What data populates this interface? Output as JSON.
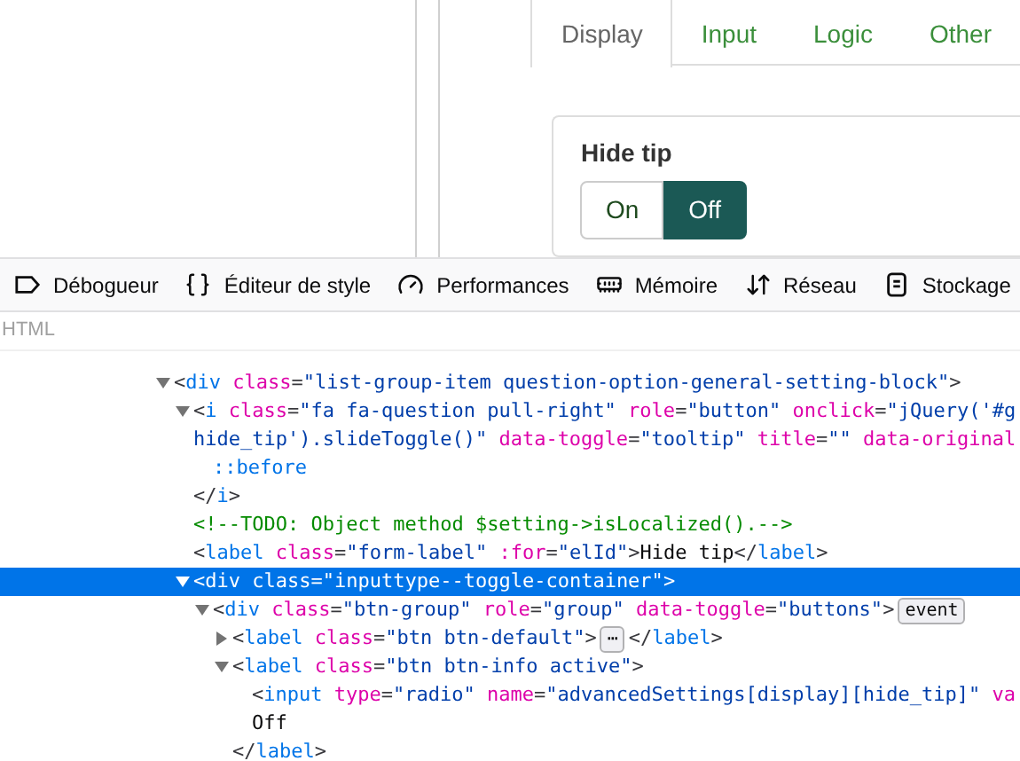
{
  "page": {
    "tabs": [
      {
        "label": "Display",
        "selected": true
      },
      {
        "label": "Input",
        "selected": false
      },
      {
        "label": "Logic",
        "selected": false
      },
      {
        "label": "Other",
        "selected": false
      }
    ],
    "setting": {
      "label": "Hide tip",
      "options": [
        {
          "label": "On",
          "selected": false
        },
        {
          "label": "Off",
          "selected": true
        }
      ]
    }
  },
  "devtools": {
    "tools": [
      {
        "kind": "debugger",
        "label": "Débogueur"
      },
      {
        "kind": "style",
        "label": "Éditeur de style"
      },
      {
        "kind": "performance",
        "label": "Performances"
      },
      {
        "kind": "memory",
        "label": "Mémoire"
      },
      {
        "kind": "network",
        "label": "Réseau"
      },
      {
        "kind": "storage",
        "label": "Stockage"
      }
    ],
    "breadcrumb": "HTML",
    "tree": [
      {
        "expanded": true,
        "selected": false,
        "lines": [
          [
            {
              "kind": "p",
              "text": "<"
            },
            {
              "kind": "tag",
              "text": "div"
            },
            {
              "kind": "attr",
              "text": " class"
            },
            {
              "kind": "p",
              "text": "="
            },
            {
              "kind": "val",
              "text": "\"list-group-item question-option-general-setting-block\""
            },
            {
              "kind": "p",
              "text": ">"
            }
          ]
        ],
        "children": [
          {
            "expanded": true,
            "selected": false,
            "lines": [
              [
                {
                  "kind": "p",
                  "text": "<"
                },
                {
                  "kind": "tag",
                  "text": "i"
                },
                {
                  "kind": "attr",
                  "text": " class"
                },
                {
                  "kind": "p",
                  "text": "="
                },
                {
                  "kind": "val",
                  "text": "\"fa fa-question pull-right\""
                },
                {
                  "kind": "attr",
                  "text": " role"
                },
                {
                  "kind": "p",
                  "text": "="
                },
                {
                  "kind": "val",
                  "text": "\"button\""
                },
                {
                  "kind": "attr",
                  "text": " onclick"
                },
                {
                  "kind": "p",
                  "text": "="
                },
                {
                  "kind": "val",
                  "text": "\"jQuery('#g"
                }
              ],
              [
                {
                  "kind": "val",
                  "text": "hide_tip').slideToggle()\""
                },
                {
                  "kind": "attr",
                  "text": " data-toggle"
                },
                {
                  "kind": "p",
                  "text": "="
                },
                {
                  "kind": "val",
                  "text": "\"tooltip\""
                },
                {
                  "kind": "attr",
                  "text": " title"
                },
                {
                  "kind": "p",
                  "text": "="
                },
                {
                  "kind": "val",
                  "text": "\"\""
                },
                {
                  "kind": "attr",
                  "text": " data-original"
                }
              ]
            ],
            "children": [
              {
                "selected": false,
                "lines": [
                  [
                    {
                      "kind": "pseudo",
                      "text": "::before"
                    }
                  ]
                ]
              }
            ]
          },
          {
            "selected": false,
            "lines": [
              [
                {
                  "kind": "p",
                  "text": "</"
                },
                {
                  "kind": "tag",
                  "text": "i"
                },
                {
                  "kind": "p",
                  "text": ">"
                }
              ]
            ]
          },
          {
            "selected": false,
            "lines": [
              [
                {
                  "kind": "comment",
                  "text": "<!--TODO: Object method $setting->isLocalized().-->"
                }
              ]
            ]
          },
          {
            "selected": false,
            "lines": [
              [
                {
                  "kind": "p",
                  "text": "<"
                },
                {
                  "kind": "tag",
                  "text": "label"
                },
                {
                  "kind": "attr",
                  "text": " class"
                },
                {
                  "kind": "p",
                  "text": "="
                },
                {
                  "kind": "val",
                  "text": "\"form-label\""
                },
                {
                  "kind": "attr",
                  "text": " :for"
                },
                {
                  "kind": "p",
                  "text": "="
                },
                {
                  "kind": "val",
                  "text": "\"elId\""
                },
                {
                  "kind": "p",
                  "text": ">"
                },
                {
                  "kind": "text",
                  "text": "Hide tip"
                },
                {
                  "kind": "p",
                  "text": "</"
                },
                {
                  "kind": "tag",
                  "text": "label"
                },
                {
                  "kind": "p",
                  "text": ">"
                }
              ]
            ]
          },
          {
            "expanded": true,
            "selected": true,
            "lines": [
              [
                {
                  "kind": "p",
                  "text": "<"
                },
                {
                  "kind": "tag",
                  "text": "div"
                },
                {
                  "kind": "attr",
                  "text": " class"
                },
                {
                  "kind": "p",
                  "text": "="
                },
                {
                  "kind": "val",
                  "text": "\"inputtype--toggle-container\""
                },
                {
                  "kind": "p",
                  "text": ">"
                }
              ]
            ],
            "children": [
              {
                "expanded": true,
                "selected": false,
                "lines": [
                  [
                    {
                      "kind": "p",
                      "text": "<"
                    },
                    {
                      "kind": "tag",
                      "text": "div"
                    },
                    {
                      "kind": "attr",
                      "text": " class"
                    },
                    {
                      "kind": "p",
                      "text": "="
                    },
                    {
                      "kind": "val",
                      "text": "\"btn-group\""
                    },
                    {
                      "kind": "attr",
                      "text": " role"
                    },
                    {
                      "kind": "p",
                      "text": "="
                    },
                    {
                      "kind": "val",
                      "text": "\"group\""
                    },
                    {
                      "kind": "attr",
                      "text": " data-toggle"
                    },
                    {
                      "kind": "p",
                      "text": "="
                    },
                    {
                      "kind": "val",
                      "text": "\"buttons\""
                    },
                    {
                      "kind": "p",
                      "text": ">"
                    },
                    {
                      "kind": "badge",
                      "text": "event"
                    }
                  ]
                ],
                "children": [
                  {
                    "expanded": false,
                    "selected": false,
                    "lines": [
                      [
                        {
                          "kind": "p",
                          "text": "<"
                        },
                        {
                          "kind": "tag",
                          "text": "label"
                        },
                        {
                          "kind": "attr",
                          "text": " class"
                        },
                        {
                          "kind": "p",
                          "text": "="
                        },
                        {
                          "kind": "val",
                          "text": "\"btn btn-default\""
                        },
                        {
                          "kind": "p",
                          "text": ">"
                        },
                        {
                          "kind": "badge",
                          "text": "⋯"
                        },
                        {
                          "kind": "p",
                          "text": "</"
                        },
                        {
                          "kind": "tag",
                          "text": "label"
                        },
                        {
                          "kind": "p",
                          "text": ">"
                        }
                      ]
                    ]
                  },
                  {
                    "expanded": true,
                    "selected": false,
                    "lines": [
                      [
                        {
                          "kind": "p",
                          "text": "<"
                        },
                        {
                          "kind": "tag",
                          "text": "label"
                        },
                        {
                          "kind": "attr",
                          "text": " class"
                        },
                        {
                          "kind": "p",
                          "text": "="
                        },
                        {
                          "kind": "val",
                          "text": "\"btn btn-info active\""
                        },
                        {
                          "kind": "p",
                          "text": ">"
                        }
                      ]
                    ],
                    "children": [
                      {
                        "selected": false,
                        "lines": [
                          [
                            {
                              "kind": "p",
                              "text": "<"
                            },
                            {
                              "kind": "tag",
                              "text": "input"
                            },
                            {
                              "kind": "attr",
                              "text": " type"
                            },
                            {
                              "kind": "p",
                              "text": "="
                            },
                            {
                              "kind": "val",
                              "text": "\"radio\""
                            },
                            {
                              "kind": "attr",
                              "text": " name"
                            },
                            {
                              "kind": "p",
                              "text": "="
                            },
                            {
                              "kind": "val",
                              "text": "\"advancedSettings[display][hide_tip]\""
                            },
                            {
                              "kind": "attr",
                              "text": " va"
                            }
                          ]
                        ]
                      },
                      {
                        "selected": false,
                        "lines": [
                          [
                            {
                              "kind": "text",
                              "text": "Off"
                            }
                          ]
                        ]
                      }
                    ]
                  },
                  {
                    "selected": false,
                    "lines": [
                      [
                        {
                          "kind": "p",
                          "text": "</"
                        },
                        {
                          "kind": "tag",
                          "text": "label"
                        },
                        {
                          "kind": "p",
                          "text": ">"
                        }
                      ]
                    ]
                  }
                ]
              }
            ]
          }
        ]
      }
    ]
  }
}
